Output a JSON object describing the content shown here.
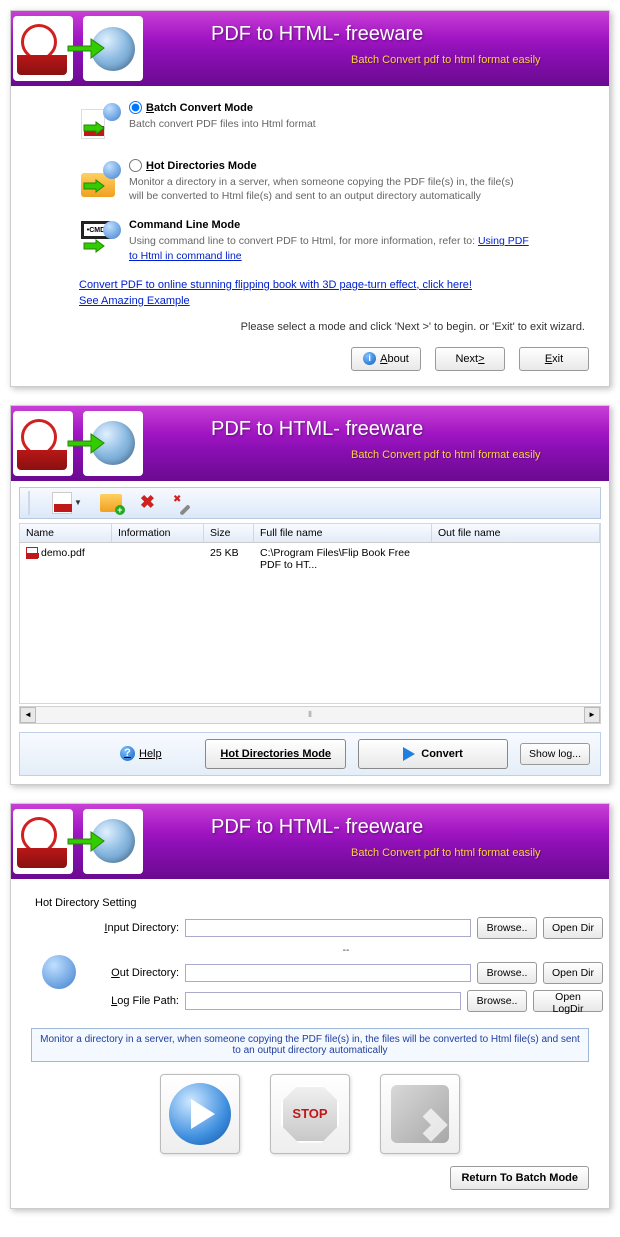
{
  "header": {
    "title": "PDF to HTML- freeware",
    "subtitle": "Batch Convert  pdf to html format easily"
  },
  "wizard": {
    "modes": {
      "batch": {
        "title": "Batch Convert Mode",
        "desc": "Batch convert PDF files into Html format"
      },
      "hot": {
        "title": "Hot Directories Mode",
        "desc": "Monitor a directory in a server, when someone copying the PDF file(s) in, the file(s) will be converted to Html file(s) and sent to an output directory automatically"
      },
      "cmd": {
        "title": "Command Line Mode",
        "desc_prefix": "Using command line to convert PDF to Html, for more information, refer to:  ",
        "link": "Using PDF to Html in command line"
      }
    },
    "link1": "Convert PDF to online stunning flipping book with 3D page-turn effect, click here!",
    "link2": "See Amazing Example ",
    "hint": "Please select a mode and click 'Next >' to begin. or 'Exit' to exit wizard.",
    "buttons": {
      "about": "About",
      "next": "Next >",
      "exit": "Exit"
    }
  },
  "grid": {
    "columns": {
      "name": "Name",
      "info": "Information",
      "size": "Size",
      "full": "Full file name",
      "out": "Out file name"
    },
    "row": {
      "name": "demo.pdf",
      "info": "",
      "size": "25 KB",
      "full": "C:\\Program Files\\Flip Book Free PDF to HT...",
      "out": ""
    },
    "help": "Help",
    "hotdir": "Hot Directories Mode",
    "convert": "Convert",
    "showlog": "Show log..."
  },
  "hotdir": {
    "section": "Hot Directory Setting",
    "input_label": "Input Directory:",
    "out_label": "Out Directory:",
    "log_label": "Log File Path:",
    "browse": "Browse..",
    "opendir": "Open Dir",
    "openlog": "Open LogDir",
    "sep": "--",
    "info": "Monitor a directory in a server, when someone copying the PDF file(s) in, the files will be converted to Html file(s) and sent to an output directory automatically",
    "stop": "STOP",
    "return": "Return To Batch Mode"
  }
}
